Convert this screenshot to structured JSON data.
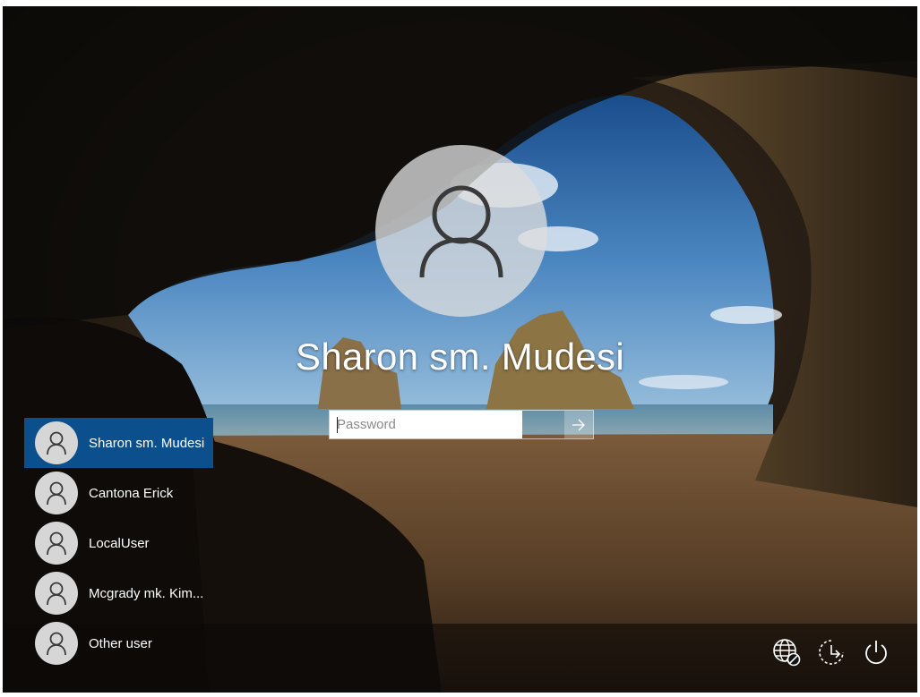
{
  "login": {
    "display_name": "Sharon sm. Mudesi",
    "password_placeholder": "Password",
    "password_value": ""
  },
  "users": [
    {
      "name": "Sharon sm. Mudesi",
      "selected": true
    },
    {
      "name": "Cantona Erick",
      "selected": false
    },
    {
      "name": "LocalUser",
      "selected": false
    },
    {
      "name": "Mcgrady mk. Kim...",
      "selected": false
    },
    {
      "name": "Other user",
      "selected": false
    }
  ],
  "corner_icons": [
    "network-icon",
    "ease-of-access-icon",
    "power-icon"
  ],
  "colors": {
    "selected_user": "#0b4f8c",
    "text": "#ffffff"
  }
}
